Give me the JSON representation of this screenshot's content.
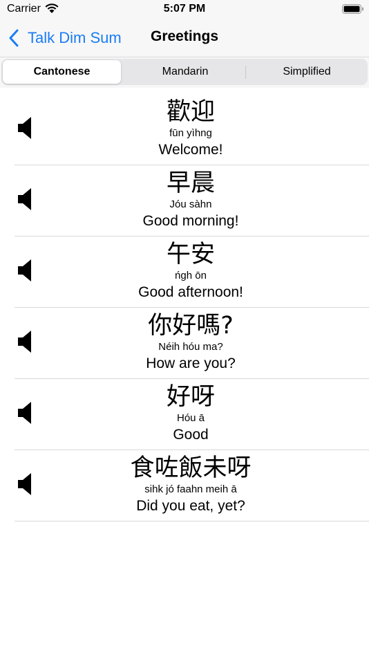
{
  "status_bar": {
    "carrier": "Carrier",
    "time": "5:07 PM",
    "icons": [
      "wifi-icon",
      "battery-icon"
    ]
  },
  "nav": {
    "back_label": "Talk Dim Sum",
    "title": "Greetings",
    "accent_color": "#1a7cf5"
  },
  "segments": {
    "selected": "Cantonese",
    "items": [
      {
        "label": "Cantonese"
      },
      {
        "label": "Mandarin"
      },
      {
        "label": "Simplified"
      }
    ]
  },
  "phrases": [
    {
      "chinese": "歡迎",
      "romanization": "fūn yìhng",
      "english": "Welcome!"
    },
    {
      "chinese": "早晨",
      "romanization": "Jóu sàhn",
      "english": "Good morning!"
    },
    {
      "chinese": "午安",
      "romanization": "ńgh ōn",
      "english": "Good afternoon!"
    },
    {
      "chinese": "你好嗎?",
      "romanization": "Néih hóu ma?",
      "english": "How are you?"
    },
    {
      "chinese": "好呀",
      "romanization": "Hóu ā",
      "english": "Good"
    },
    {
      "chinese": "食咗飯未呀",
      "romanization": "sihk jó faahn meih ā",
      "english": "Did you eat, yet?"
    }
  ]
}
